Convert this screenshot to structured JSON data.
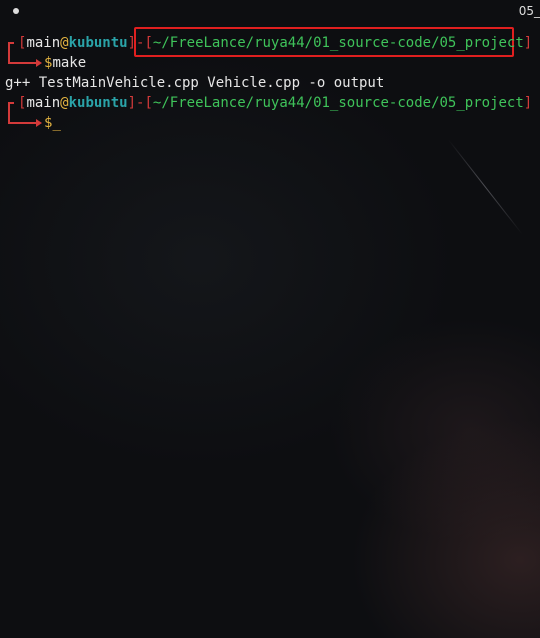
{
  "topbar": {
    "right_text": "05_"
  },
  "colors": {
    "bracket": "#d33a3a",
    "path": "#3fc35a",
    "host": "#2aa3a8",
    "dollar": "#e3b341",
    "highlight_box": "#e01f1f"
  },
  "prompt1": {
    "user": "main",
    "at": "@",
    "host": "kubuntu",
    "path": "~/FreeLance/ruya44/01_source-code/05_project",
    "dollar": "$",
    "command": "make"
  },
  "output": {
    "line1": "g++ TestMainVehicle.cpp Vehicle.cpp -o output"
  },
  "prompt2": {
    "user": "main",
    "at": "@",
    "host": "kubuntu",
    "path": "~/FreeLance/ruya44/01_source-code/05_project",
    "dollar": "$",
    "cursor": "_"
  }
}
